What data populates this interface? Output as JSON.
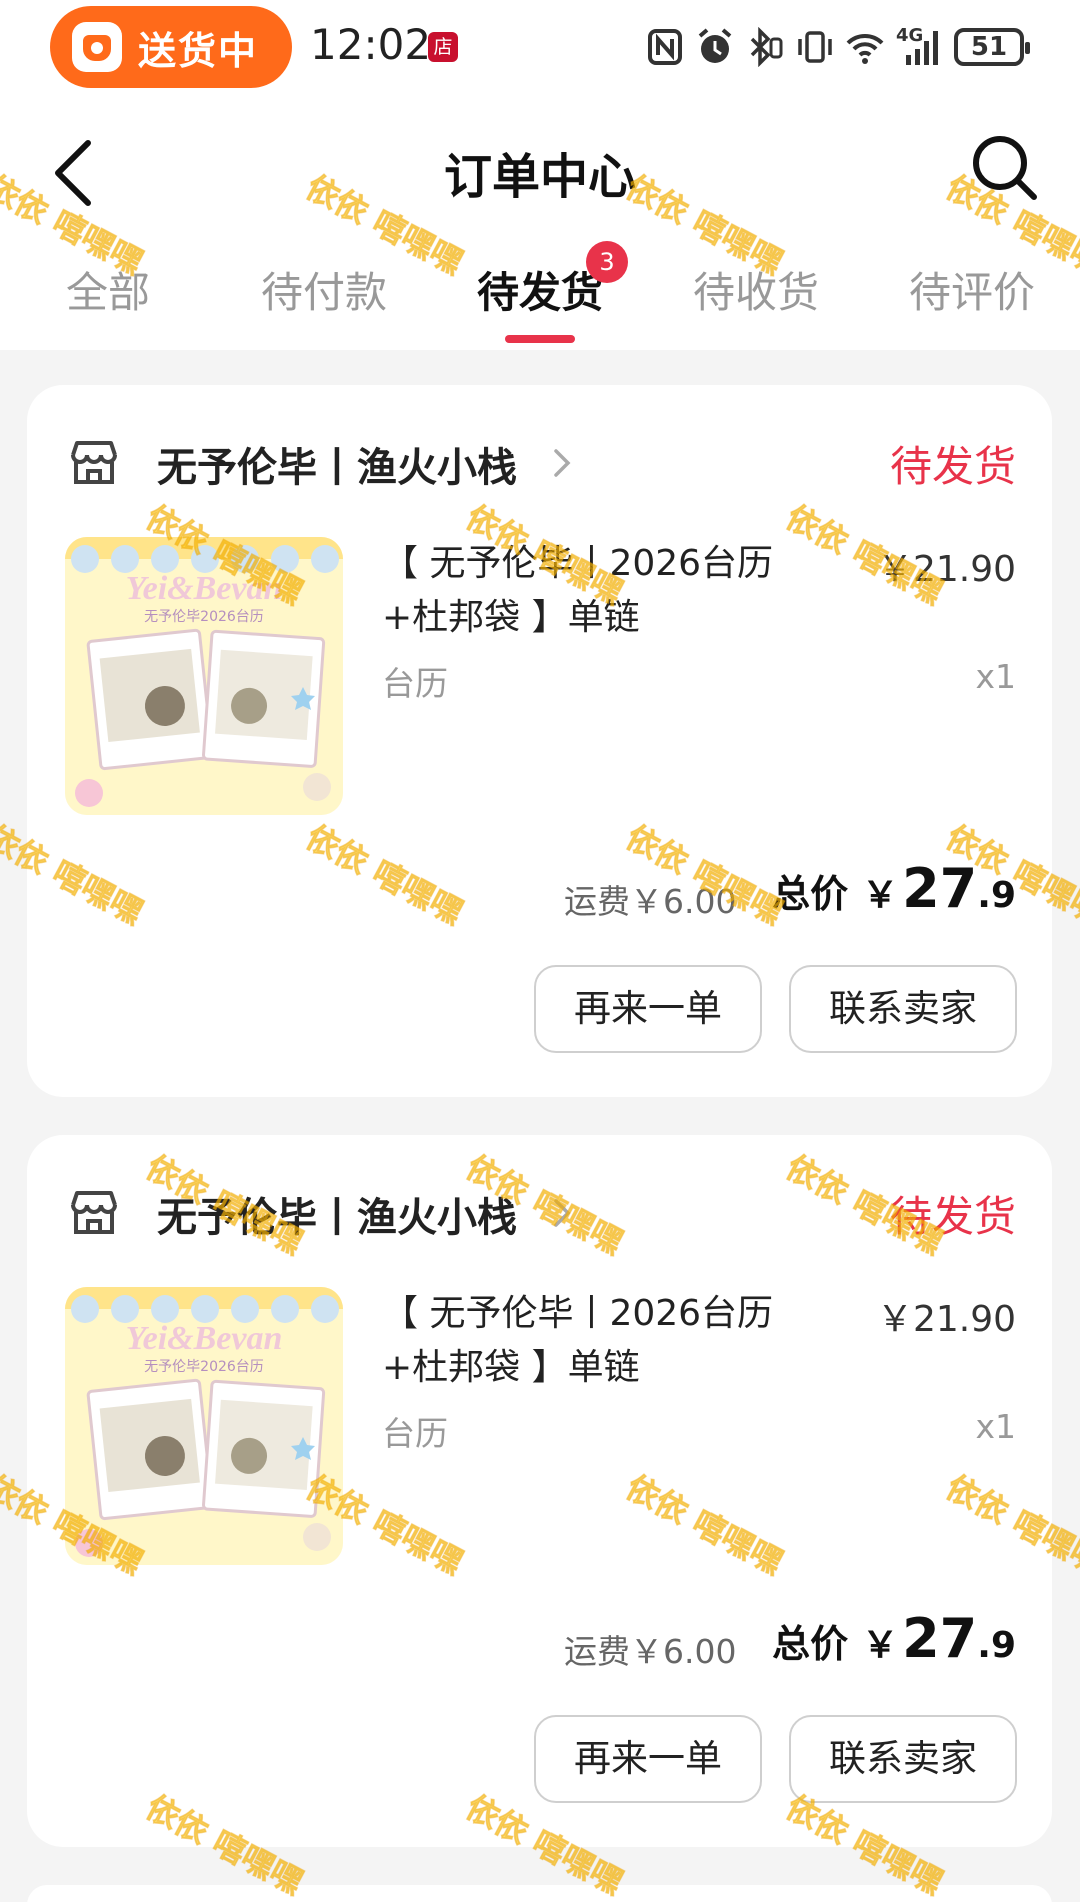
{
  "status_bar": {
    "delivery_label": "送货中",
    "time": "12:02",
    "store_badge": "店",
    "network": "4G",
    "battery": "51",
    "icons": [
      "nfc-icon",
      "alarm-icon",
      "bluetooth-icon",
      "vibrate-icon",
      "wifi-icon",
      "signal-icon",
      "battery-icon"
    ]
  },
  "header": {
    "title": "订单中心",
    "back_icon": "back-arrow-icon",
    "search_icon": "search-icon"
  },
  "tabs": [
    {
      "label": "全部",
      "active": false
    },
    {
      "label": "待付款",
      "active": false
    },
    {
      "label": "待发货",
      "active": true,
      "badge": "3"
    },
    {
      "label": "待收货",
      "active": false
    },
    {
      "label": "待评价",
      "active": false
    }
  ],
  "orders": [
    {
      "shop_name": "无予伦毕丨渔火小栈",
      "status": "待发货",
      "product_title": "【 无予伦毕丨2026台历+杜邦袋 】单链",
      "price": "￥21.90",
      "spec": "台历",
      "quantity": "x1",
      "shipping": "运费￥6.00",
      "total_label": "总价",
      "total_currency": "￥",
      "total_int": "27",
      "total_dec": ".9",
      "thumb_text": "Yei&Bevan",
      "thumb_subtext": "无予伦毕2026台历",
      "buttons": {
        "reorder": "再来一单",
        "contact": "联系卖家"
      }
    },
    {
      "shop_name": "无予伦毕丨渔火小栈",
      "status": "待发货",
      "product_title": "【 无予伦毕丨2026台历+杜邦袋 】单链",
      "price": "￥21.90",
      "spec": "台历",
      "quantity": "x1",
      "shipping": "运费￥6.00",
      "total_label": "总价",
      "total_currency": "￥",
      "total_int": "27",
      "total_dec": ".9",
      "thumb_text": "Yei&Bevan",
      "thumb_subtext": "无予伦毕2026台历",
      "buttons": {
        "reorder": "再来一单",
        "contact": "联系卖家"
      }
    }
  ],
  "watermark_text": "依依 嘻嘿嘿",
  "colors": {
    "accent": "#e8334a",
    "delivery_pill": "#ff6a1a",
    "watermark": "#ffc800"
  }
}
